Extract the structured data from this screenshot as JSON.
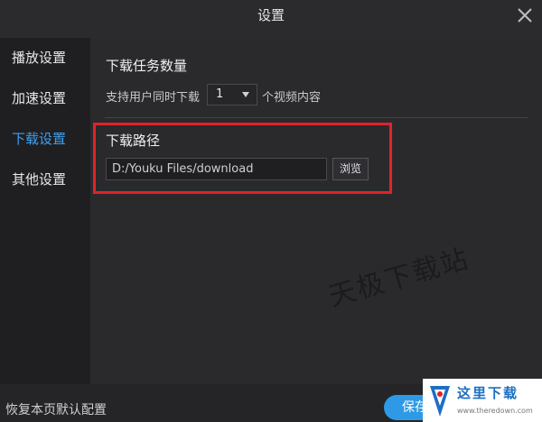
{
  "window": {
    "title": "设置"
  },
  "sidebar": {
    "items": [
      {
        "label": "播放设置",
        "active": false
      },
      {
        "label": "加速设置",
        "active": false
      },
      {
        "label": "下载设置",
        "active": true
      },
      {
        "label": "其他设置",
        "active": false
      }
    ]
  },
  "download_tasks": {
    "title": "下载任务数量",
    "prefix": "支持用户同时下载",
    "selected_value": "1",
    "suffix": "个视频内容"
  },
  "download_path": {
    "title": "下载路径",
    "value": "D:/Youku Files/download",
    "browse_label": "浏览"
  },
  "watermark": {
    "text": "天极下载站"
  },
  "footer": {
    "restore_label": "恢复本页默认配置",
    "save_label": "保存"
  },
  "badge": {
    "text": "这里下载",
    "url": "www.theredown.com"
  },
  "colors": {
    "accent": "#3ea0f0",
    "save_button": "#2e9ae6",
    "highlight_border": "#e3222b"
  },
  "icons": {
    "close": "close-icon",
    "dropdown": "chevron-down-icon"
  }
}
